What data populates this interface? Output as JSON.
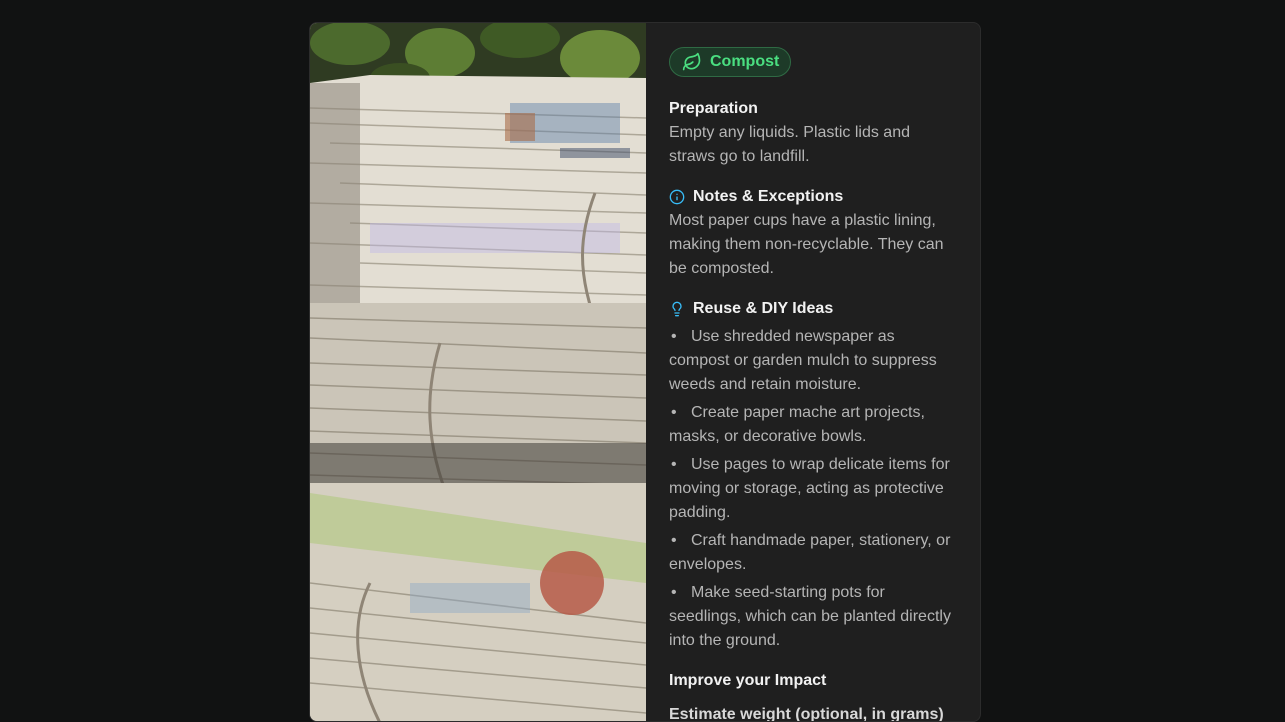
{
  "badge": {
    "label": "Compost",
    "icon": "leaf-icon",
    "color": "#4ade80"
  },
  "preparation": {
    "title": "Preparation",
    "text": "Empty any liquids. Plastic lids and straws go to landfill."
  },
  "notes": {
    "title": "Notes & Exceptions",
    "icon": "info-icon",
    "text": "Most paper cups have a plastic lining, making them non-recyclable. They can be composted."
  },
  "reuse": {
    "title": "Reuse & DIY Ideas",
    "icon": "lightbulb-icon",
    "items": [
      "Use shredded newspaper as compost or garden mulch to suppress weeds and retain moisture.",
      "Create paper mache art projects, masks, or decorative bowls.",
      "Use pages to wrap delicate items for moving or storage, acting as protective padding.",
      "Craft handmade paper, stationery, or envelopes.",
      "Make seed-starting pots for seedlings, which can be planted directly into the ground."
    ]
  },
  "impact": {
    "title": "Improve your Impact",
    "subtitle": "Estimate weight (optional, in grams)"
  },
  "image": {
    "alt": "Stacks of bundled newspapers tied with string"
  }
}
